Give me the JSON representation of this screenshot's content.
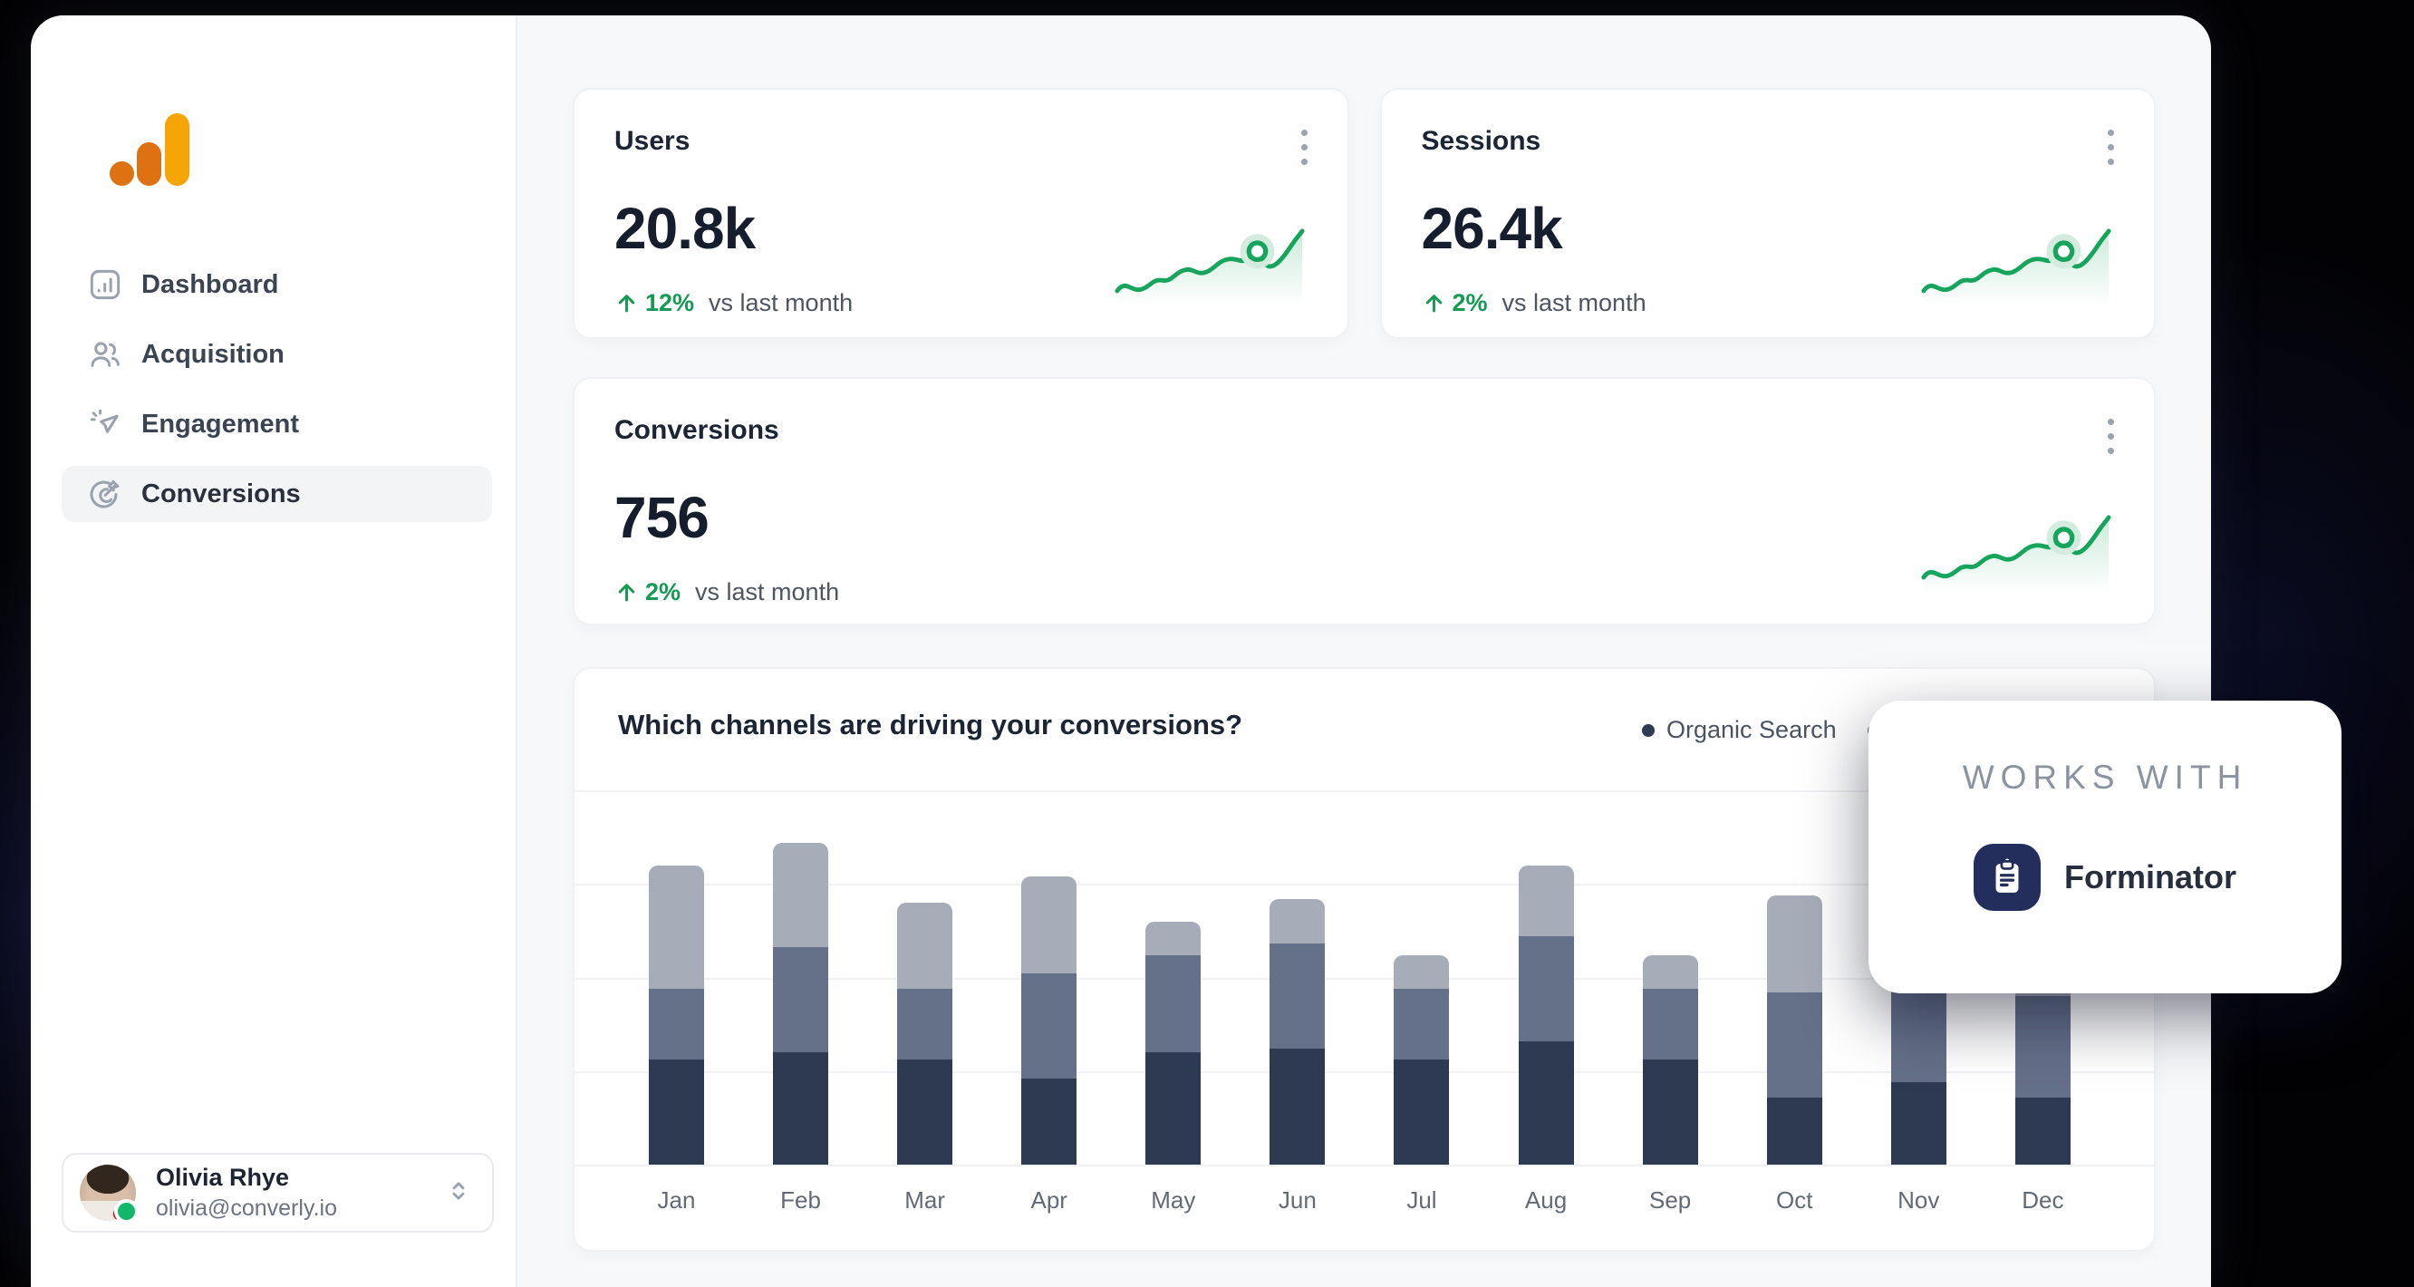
{
  "theme": {
    "green": "#17a45c",
    "navy": "#2e3a52",
    "slate": "#657089",
    "light_gray": "#a6acb8",
    "logo_amber": "#F5A506",
    "logo_orange": "#DE7212"
  },
  "sidebar": {
    "nav": [
      {
        "label": "Dashboard",
        "active": false
      },
      {
        "label": "Acquisition",
        "active": false
      },
      {
        "label": "Engagement",
        "active": false
      },
      {
        "label": "Conversions",
        "active": true
      }
    ],
    "profile": {
      "name": "Olivia Rhye",
      "email": "olivia@converly.io",
      "status": "online"
    }
  },
  "stats": [
    {
      "title": "Users",
      "value": "20.8k",
      "delta": "12%",
      "delta_direction": "up",
      "compare_label": "vs last month"
    },
    {
      "title": "Sessions",
      "value": "26.4k",
      "delta": "2%",
      "delta_direction": "up",
      "compare_label": "vs last month"
    },
    {
      "title": "Conversions",
      "value": "756",
      "delta": "2%",
      "delta_direction": "up",
      "compare_label": "vs last month"
    }
  ],
  "chart_data": {
    "type": "bar",
    "stacked": true,
    "title": "Which channels are driving your conversions?",
    "categories": [
      "Jan",
      "Feb",
      "Mar",
      "Apr",
      "May",
      "Jun",
      "Jul",
      "Aug",
      "Sep",
      "Oct",
      "Nov",
      "Dec"
    ],
    "series": [
      {
        "name": "Organic Search",
        "color": "#2e3a52",
        "values": [
          28,
          30,
          28,
          23,
          30,
          31,
          28,
          33,
          28,
          18,
          22,
          18
        ]
      },
      {
        "name": "",
        "color": "#657089",
        "values": [
          19,
          28,
          19,
          28,
          26,
          28,
          19,
          28,
          19,
          28,
          26,
          27
        ]
      },
      {
        "name": "",
        "color": "#a6acb8",
        "values": [
          33,
          28,
          23,
          26,
          9,
          12,
          9,
          19,
          9,
          26,
          12,
          11
        ]
      }
    ],
    "ylim": [
      0,
      100
    ],
    "grid": true,
    "legend_position": "top-right"
  },
  "works_with": {
    "heading": "WORKS WITH",
    "app_name": "Forminator"
  }
}
